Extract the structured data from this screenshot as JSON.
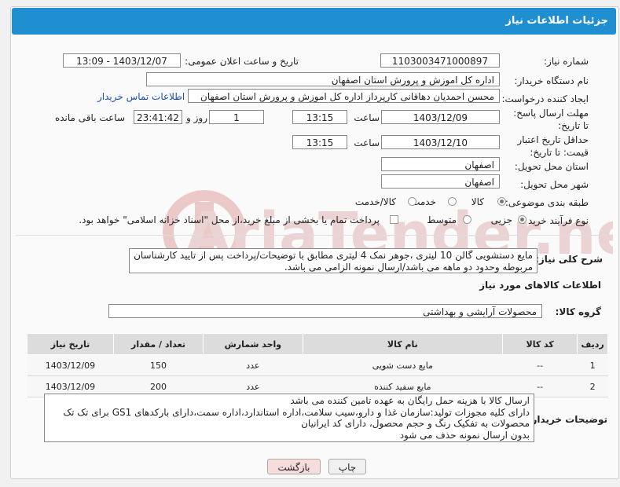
{
  "header": {
    "title": "جزئیات اطلاعات نیاز"
  },
  "fields": {
    "need_number_label": "شماره نیاز:",
    "need_number": "1103003471000897",
    "announce_label": "تاریخ و ساعت اعلان عمومی:",
    "announce_value": "1403/12/07 - 13:09",
    "buyer_org_label": "نام دستگاه خریدار:",
    "buyer_org": "اداره کل اموزش و پرورش استان اصفهان",
    "requester_label": "ایجاد کننده درخواست:",
    "requester": "محسن احمدیان دهاقانی کارپرداز اداره کل اموزش و پرورش استان اصفهان",
    "contact_link": "اطلاعات تماس خریدار",
    "deadline_label": "مهلت ارسال پاسخ: تا تاریخ:",
    "deadline_date": "1403/12/09",
    "time_label": "ساعت",
    "deadline_time": "13:15",
    "day_label": "روز و",
    "days": "1",
    "remaining": "23:41:42",
    "remaining_label": "ساعت باقی مانده",
    "validity_label": "حداقل تاریخ اعتبار قیمت: تا تاریخ:",
    "validity_date": "1403/12/10",
    "validity_time": "13:15",
    "province_label": "استان محل تحویل:",
    "province": "اصفهان",
    "city_label": "شهر محل تحویل:",
    "city": "اصفهان",
    "category_label": "طبقه بندی موضوعی:",
    "category_options": [
      "کالا",
      "خدمت",
      "کالا/خدمت"
    ],
    "process_label": "نوع فرآیند خرید :",
    "process_options": [
      "جزیی",
      "متوسط"
    ],
    "process_note": "پرداخت تمام یا بخشی از مبلغ خرید،از محل \"اسناد خزانه اسلامی\" خواهد بود."
  },
  "description": {
    "label": "شرح کلی نیاز:",
    "text": "مایع دستشویی گالن 10 لیتری ،جوهر نمک 4 لیتری مطابق با توضیحات/پرداخت پس از تایید کارشناسان مربوطه وحدود دو ماهه می باشد/ارسال نمونه الزامی می باشد."
  },
  "goods": {
    "section_title": "اطلاعات کالاهای مورد نیاز",
    "group_label": "گروه کالا:",
    "group_value": "محصولات آرایشی و بهداشتی",
    "columns": [
      "ردیف",
      "کد کالا",
      "نام کالا",
      "واحد شمارش",
      "تعداد / مقدار",
      "تاریخ نیاز"
    ],
    "rows": [
      {
        "row": "1",
        "code": "--",
        "name": "مایع دست شویی",
        "unit": "عدد",
        "qty": "150",
        "date": "1403/12/09"
      },
      {
        "row": "2",
        "code": "--",
        "name": "مایع سفید کننده",
        "unit": "عدد",
        "qty": "200",
        "date": "1403/12/09"
      }
    ]
  },
  "buyer_notes": {
    "label": "توضیحات خریدار:",
    "lines": [
      "ارسال کالا با هزینه حمل رایگان به عهده تامین کننده می باشد",
      "دارای کلیه مجوزات تولید:سازمان غذا و دارو،سیب سلامت،اداره استاندارد،اداره سمت،دارای بارکدهای GS1 برای تک تک",
      "محصولات به تفکیک رنگ و حجم محصول، دارای کد ایرانیان",
      "بدون ارسال نمونه حذف می شود"
    ]
  },
  "buttons": {
    "print": "چاپ",
    "back": "بازگشت"
  },
  "colors": {
    "header_bg": "#1f8fd1",
    "back_btn_bg": "#f7dcdc",
    "watermark": "#e6b8b8"
  }
}
